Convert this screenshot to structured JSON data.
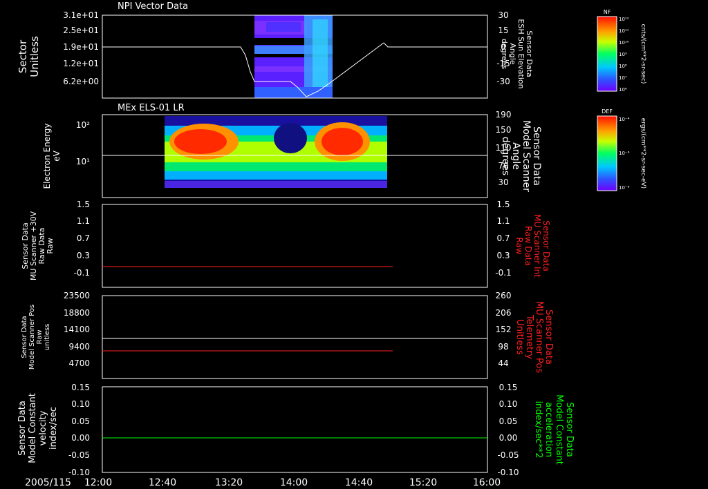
{
  "date_label": "2005/115",
  "x_ticks": [
    "12:00",
    "12:40",
    "13:20",
    "14:00",
    "14:40",
    "15:20",
    "16:00"
  ],
  "colors": {
    "frame": "#ffffff",
    "red": "#ff2020",
    "green": "#00ff00"
  },
  "panels": [
    {
      "title": "NPI Vector Data",
      "left_label": [
        "Sector",
        "Unitless"
      ],
      "left_ticks": [
        "3.1e+01",
        "2.5e+01",
        "1.9e+01",
        "1.2e+01",
        "6.2e+00"
      ],
      "right_label": [
        "Sensor Data",
        "ESH Sun Elevation",
        "Angle",
        "degrees"
      ],
      "right_ticks": [
        "30",
        "15",
        "0",
        "-15",
        "-30"
      ]
    },
    {
      "title": "MEx ELS-01 LR",
      "left_label": [
        "Electron Energy",
        "eV"
      ],
      "left_ticks": [
        "10²",
        "10¹"
      ],
      "right_label": [
        "Sensor Data",
        "Model Scanner",
        "Angle",
        "degrees"
      ],
      "right_ticks": [
        "190",
        "150",
        "110",
        "70",
        "30"
      ]
    },
    {
      "title": "",
      "left_label": [
        "Sensor Data",
        "MU Scanner +30V",
        "Raw Data",
        "Raw"
      ],
      "left_ticks": [
        "1.5",
        "1.1",
        "0.7",
        "0.3",
        "-0.1"
      ],
      "right_label": [
        "Sensor Data",
        "MU Scanner Int",
        "Raw Data",
        "Raw"
      ],
      "right_ticks": [
        "1.5",
        "1.1",
        "0.7",
        "0.3",
        "-0.1"
      ]
    },
    {
      "title": "",
      "left_label": [
        "Sensor Data",
        "Model Scanner Pos",
        "Raw",
        "unitless"
      ],
      "left_ticks": [
        "23500",
        "18800",
        "14100",
        "9400",
        "4700"
      ],
      "right_label": [
        "Sensor Data",
        "MU Scanner Pos",
        "Telemetry",
        "Unitless"
      ],
      "right_ticks": [
        "260",
        "206",
        "152",
        "98",
        "44"
      ]
    },
    {
      "title": "",
      "left_label": [
        "Sensor Data",
        "Model Constant",
        "velocity",
        "index/sec"
      ],
      "left_ticks": [
        "0.15",
        "0.10",
        "0.05",
        "0.00",
        "-0.05",
        "-0.10"
      ],
      "right_label": [
        "Sensor Data",
        "Model Constant",
        "acceleration",
        "index/sec**2"
      ],
      "right_ticks": [
        "0.15",
        "0.10",
        "0.05",
        "0.00",
        "-0.05",
        "-0.10"
      ]
    }
  ],
  "colorbars": [
    {
      "tag": "NF",
      "unit": "cnts/(cm**2-sr-sec)",
      "ticks": [
        "10¹²",
        "10¹¹",
        "10¹⁰",
        "10⁹",
        "10⁸",
        "10⁷",
        "10⁶"
      ]
    },
    {
      "tag": "DEF",
      "unit": "ergs/(cm**2-sr-sec-eV)",
      "ticks": [
        "10⁻⁴",
        "10⁻⁶",
        "10⁻⁸"
      ]
    }
  ],
  "chart_data": [
    {
      "type": "line",
      "title": "NPI Vector Data",
      "x_unit": "time",
      "ylabel": "Sector Unitless",
      "y2label": "Sensor Data ESH Sun Elevation Angle degrees",
      "y2lim": [
        -45,
        30
      ],
      "spectrogram_span": [
        "13:30",
        "14:20"
      ],
      "series": [
        {
          "name": "Sensor Data ESH Sun Elevation Angle",
          "axis": "right",
          "x": [
            "12:00",
            "13:21",
            "13:25",
            "13:30",
            "13:45",
            "13:52",
            "14:00",
            "14:08",
            "14:20",
            "14:40",
            "14:50",
            "14:52",
            "16:00"
          ],
          "y": [
            0,
            0,
            -10,
            -28,
            -28,
            -30,
            -41,
            -38,
            -30,
            -3,
            4,
            0,
            0
          ]
        }
      ]
    },
    {
      "type": "heatmap",
      "title": "MEx ELS-01 LR",
      "ylabel": "Electron Energy eV",
      "y2label": "Sensor Data Model Scanner Angle degrees",
      "y2lim": [
        0,
        190
      ],
      "span": [
        "12:40",
        "14:47"
      ],
      "series": [
        {
          "name": "Sensor Data Model Scanner Angle",
          "axis": "right",
          "x": [
            "12:00",
            "16:00"
          ],
          "y": [
            95,
            95
          ]
        }
      ]
    },
    {
      "type": "line",
      "ylabel": "Sensor Data MU Scanner +30V Raw Data Raw",
      "y2label": "Sensor Data MU Scanner Int Raw Data Raw",
      "ylim": [
        -0.3,
        1.5
      ],
      "series": [
        {
          "name": "Sensor Data MU Scanner Int Raw Data",
          "color": "#ff2020",
          "x": [
            "12:00",
            "14:52"
          ],
          "y": [
            0,
            0
          ]
        }
      ]
    },
    {
      "type": "line",
      "ylabel": "Sensor Data Model Scanner Pos Raw unitless",
      "y2label": "Sensor Data MU Scanner Pos Telemetry Unitless",
      "ylim": [
        0,
        23500
      ],
      "y2lim": [
        -2,
        260
      ],
      "series": [
        {
          "name": "Sensor Data Model Scanner Pos",
          "color": "#ffffff",
          "axis": "left",
          "x": [
            "12:00",
            "16:00"
          ],
          "y": [
            11800,
            11800
          ]
        },
        {
          "name": "Sensor Data MU Scanner Pos Telemetry",
          "color": "#ff2020",
          "axis": "right",
          "x": [
            "12:00",
            "14:52"
          ],
          "y": [
            100,
            100
          ]
        }
      ]
    },
    {
      "type": "line",
      "ylabel": "Sensor Data Model Constant velocity index/sec",
      "y2label": "Sensor Data Model Constant acceleration index/sec**2",
      "ylim": [
        -0.1,
        0.15
      ],
      "series": [
        {
          "name": "Sensor Data Model Constant",
          "color": "#00ff00",
          "x": [
            "12:00",
            "16:00"
          ],
          "y": [
            0,
            0
          ]
        }
      ]
    }
  ]
}
